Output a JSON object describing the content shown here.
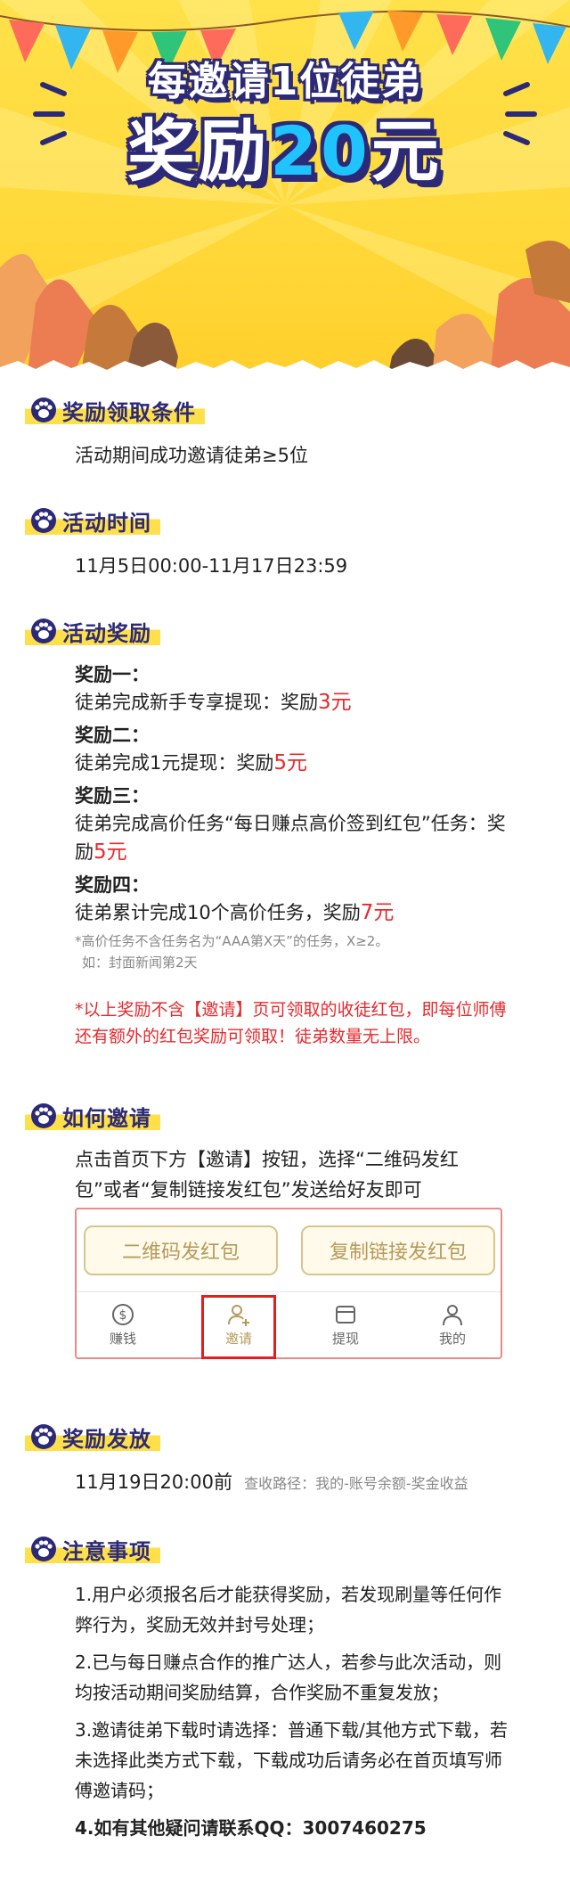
{
  "banner": {
    "line1": "每邀请1位徒弟",
    "line2_prefix": "奖励",
    "line2_amount": "20",
    "line2_suffix": "元"
  },
  "sections": {
    "conditions": {
      "title": "奖励领取条件",
      "text": "活动期间成功邀请徒弟≥5位"
    },
    "time": {
      "title": "活动时间",
      "text": "11月5日00:00-11月17日23:59"
    },
    "rewards": {
      "title": "活动奖励",
      "items": [
        {
          "label": "奖励一：",
          "desc": "徒弟完成新手专享提现：奖励",
          "amount": "3元"
        },
        {
          "label": "奖励二：",
          "desc": "徒弟完成1元提现：奖励",
          "amount": "5元"
        },
        {
          "label": "奖励三：",
          "desc": "徒弟完成高价任务“每日赚点高价签到红包”任务：奖励",
          "amount": "5元"
        },
        {
          "label": "奖励四：",
          "desc": "徒弟累计完成10个高价任务，奖励",
          "amount": "7元"
        }
      ],
      "note1": "*高价任务不含任务名为“AAA第X天”的任务，X≥2。",
      "note2": "如：封面新闻第2天",
      "warning": "*以上奖励不含【邀请】页可领取的收徒红包，即每位师傅还有额外的红包奖励可领取！徒弟数量无上限。"
    },
    "invite": {
      "title": "如何邀请",
      "text": "点击首页下方【邀请】按钮，选择“二维码发红包”或者“复制链接发红包”发送给好友即可",
      "btn_qr": "二维码发红包",
      "btn_link": "复制链接发红包",
      "tabs": [
        {
          "label": "赚钱",
          "icon": "dollar-icon"
        },
        {
          "label": "邀请",
          "icon": "add-user-icon"
        },
        {
          "label": "提现",
          "icon": "wallet-icon"
        },
        {
          "label": "我的",
          "icon": "user-icon"
        }
      ]
    },
    "payout": {
      "title": "奖励发放",
      "time": "11月19日20:00前",
      "path": "查收路径：我的-账号余额-奖金收益"
    },
    "notes": {
      "title": "注意事项",
      "items": [
        "1.用户必须报名后才能获得奖励，若发现刷量等任何作弊行为，奖励无效并封号处理；",
        "2.已与每日赚点合作的推广达人，若参与此次活动，则均按活动期间奖励结算，合作奖励不重复发放；",
        "3.邀请徒弟下载时请选择：普通下载/其他方式下载，若未选择此类方式下载，下载成功后请务必在首页填写师傅邀请码；",
        "4.如有其他疑问请联系QQ：3007460275"
      ]
    }
  },
  "colors": {
    "banner_yellow": "#ffd93a",
    "title_navy": "#2c2a78",
    "highlight_yellow": "#ffe04a",
    "accent_red": "#e8292c",
    "amount_cyan": "#1fc4ff",
    "gold": "#b59a5c"
  }
}
